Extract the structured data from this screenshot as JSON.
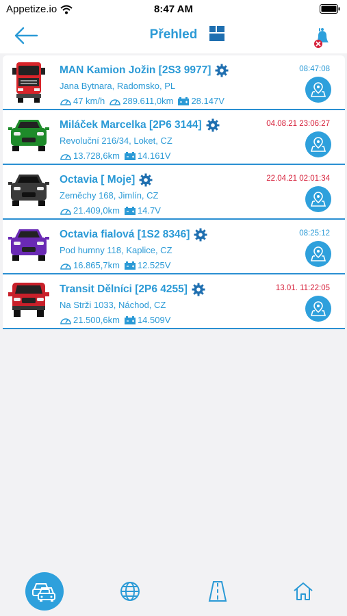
{
  "status_bar": {
    "carrier": "Appetize.io",
    "time": "8:47 AM"
  },
  "header": {
    "title": "Přehled",
    "back_icon": "arrow-left-icon",
    "grid_icon": "grid-icon",
    "alarm_icon": "bell-off-icon"
  },
  "colors": {
    "accent": "#2b9ad6",
    "alert": "#d6203a",
    "card_border": "#2a8fd2"
  },
  "vehicles": [
    {
      "name": "MAN Kamion Jožin [2S3 9977]",
      "address": "Jana Bytnara, Radomsko, PL",
      "speed": "47 km/h",
      "odometer": "289.611,0km",
      "battery": "28.147V",
      "time": "08:47:08",
      "time_status": "blue",
      "image": "red-truck-icon",
      "vehicle_color": "#d8242a"
    },
    {
      "name": "Miláček Marcelka [2P6 3144]",
      "address": "Revoluční 216/34, Loket, CZ",
      "odometer": "13.728,6km",
      "battery": "14.161V",
      "time": "04.08.21 23:06:27",
      "time_status": "red",
      "image": "green-car-icon",
      "vehicle_color": "#1e8a2a"
    },
    {
      "name": "Octavia [ Moje]",
      "address": "Zeměchy 168, Jimlín, CZ",
      "odometer": "21.409,0km",
      "battery": "14.7V",
      "time": "22.04.21 02:01:34",
      "time_status": "red",
      "image": "black-car-icon",
      "vehicle_color": "#333333"
    },
    {
      "name": "Octavia fialová [1S2 8346]",
      "address": "Pod humny 118, Kaplice, CZ",
      "odometer": "16.865,7km",
      "battery": "12.525V",
      "time": "08:25:12",
      "time_status": "blue",
      "image": "purple-car-icon",
      "vehicle_color": "#6a2ab4"
    },
    {
      "name": "Transit Dělníci [2P6 4255]",
      "address": "Na Strži 1033, Náchod, CZ",
      "odometer": "21.500,6km",
      "battery": "14.509V",
      "time": "13.01. 11:22:05",
      "time_status": "red",
      "image": "red-van-icon",
      "vehicle_color": "#c8202a"
    }
  ],
  "tabs": [
    {
      "icon": "cars-icon",
      "active": true
    },
    {
      "icon": "globe-icon",
      "active": false
    },
    {
      "icon": "road-icon",
      "active": false
    },
    {
      "icon": "home-icon",
      "active": false
    }
  ]
}
